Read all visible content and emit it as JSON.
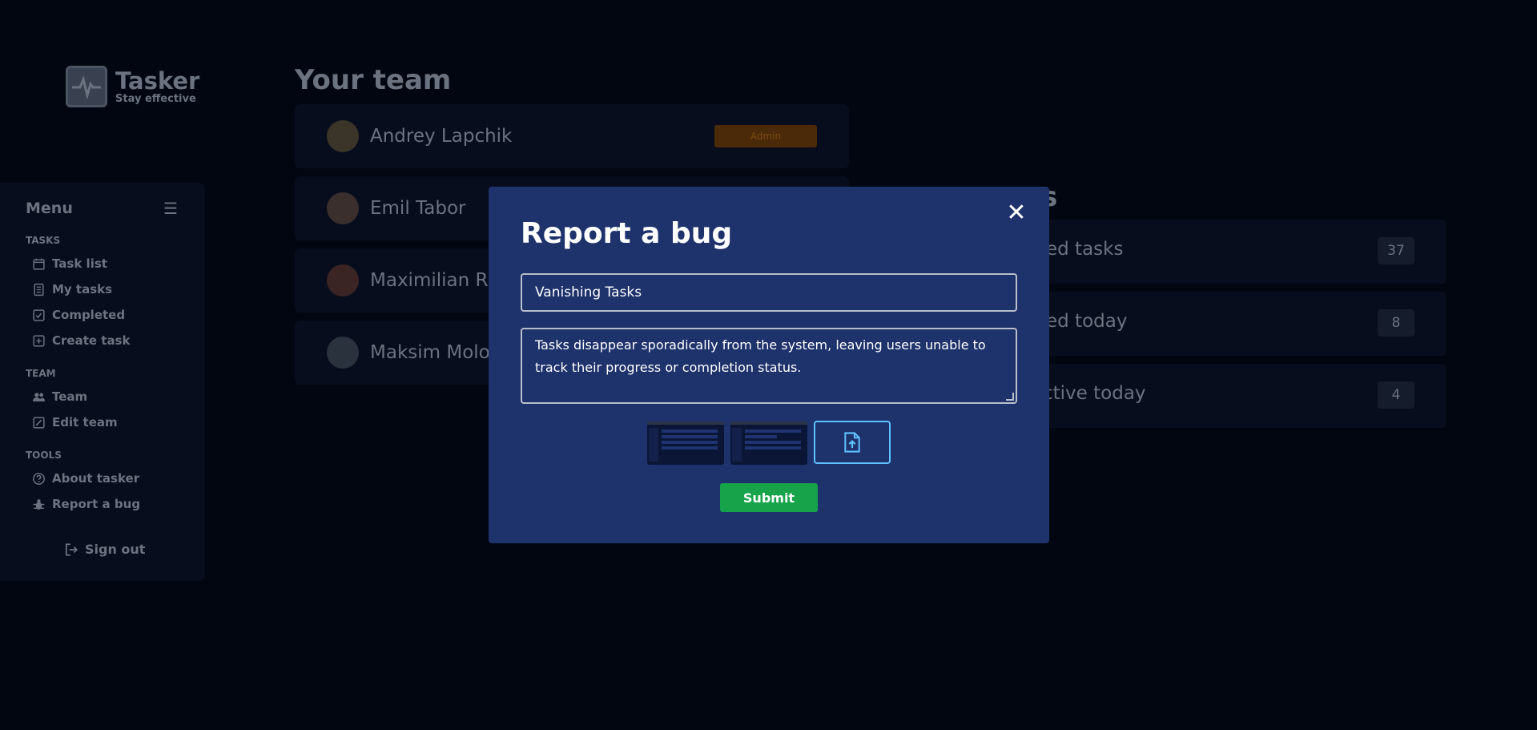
{
  "app": {
    "name": "Tasker",
    "tagline": "Stay effective"
  },
  "sidebar": {
    "menu_title": "Menu",
    "sections": [
      {
        "label": "TASKS",
        "items": [
          {
            "label": "Task list",
            "icon": "calendar-icon"
          },
          {
            "label": "My tasks",
            "icon": "document-icon"
          },
          {
            "label": "Completed",
            "icon": "check-square-icon"
          },
          {
            "label": "Create task",
            "icon": "plus-square-icon"
          }
        ]
      },
      {
        "label": "TEAM",
        "items": [
          {
            "label": "Team",
            "icon": "people-icon"
          },
          {
            "label": "Edit team",
            "icon": "edit-icon"
          }
        ]
      },
      {
        "label": "TOOLS",
        "items": [
          {
            "label": "About tasker",
            "icon": "question-circle-icon"
          },
          {
            "label": "Report a bug",
            "icon": "bug-icon"
          }
        ]
      }
    ],
    "sign_out": "Sign out"
  },
  "team": {
    "title": "Your team",
    "members": [
      {
        "name": "Andrey Lapchik",
        "badge": "Admin"
      },
      {
        "name": "Emil Tabor"
      },
      {
        "name": "Maximilian R"
      },
      {
        "name": "Maksim Molo"
      }
    ]
  },
  "progress": {
    "title_fragment": "ress",
    "stats": [
      {
        "label": "ed tasks",
        "value": "37"
      },
      {
        "label": "ed today",
        "value": "8"
      },
      {
        "label": "ctive today",
        "value": "4"
      }
    ]
  },
  "modal": {
    "title": "Report a bug",
    "bug_title_value": "Vanishing Tasks",
    "description_value": "Tasks disappear sporadically from the system, leaving users unable to track their progress or completion status.",
    "attachments_count": 2,
    "submit_label": "Submit",
    "close_icon": "close-icon",
    "upload_icon": "file-upload-icon"
  },
  "colors": {
    "background": "#020611",
    "modal": "#1e326b",
    "submit": "#16a34a",
    "upload_border": "#5ec2ff",
    "admin_badge": "#4a2a08"
  }
}
